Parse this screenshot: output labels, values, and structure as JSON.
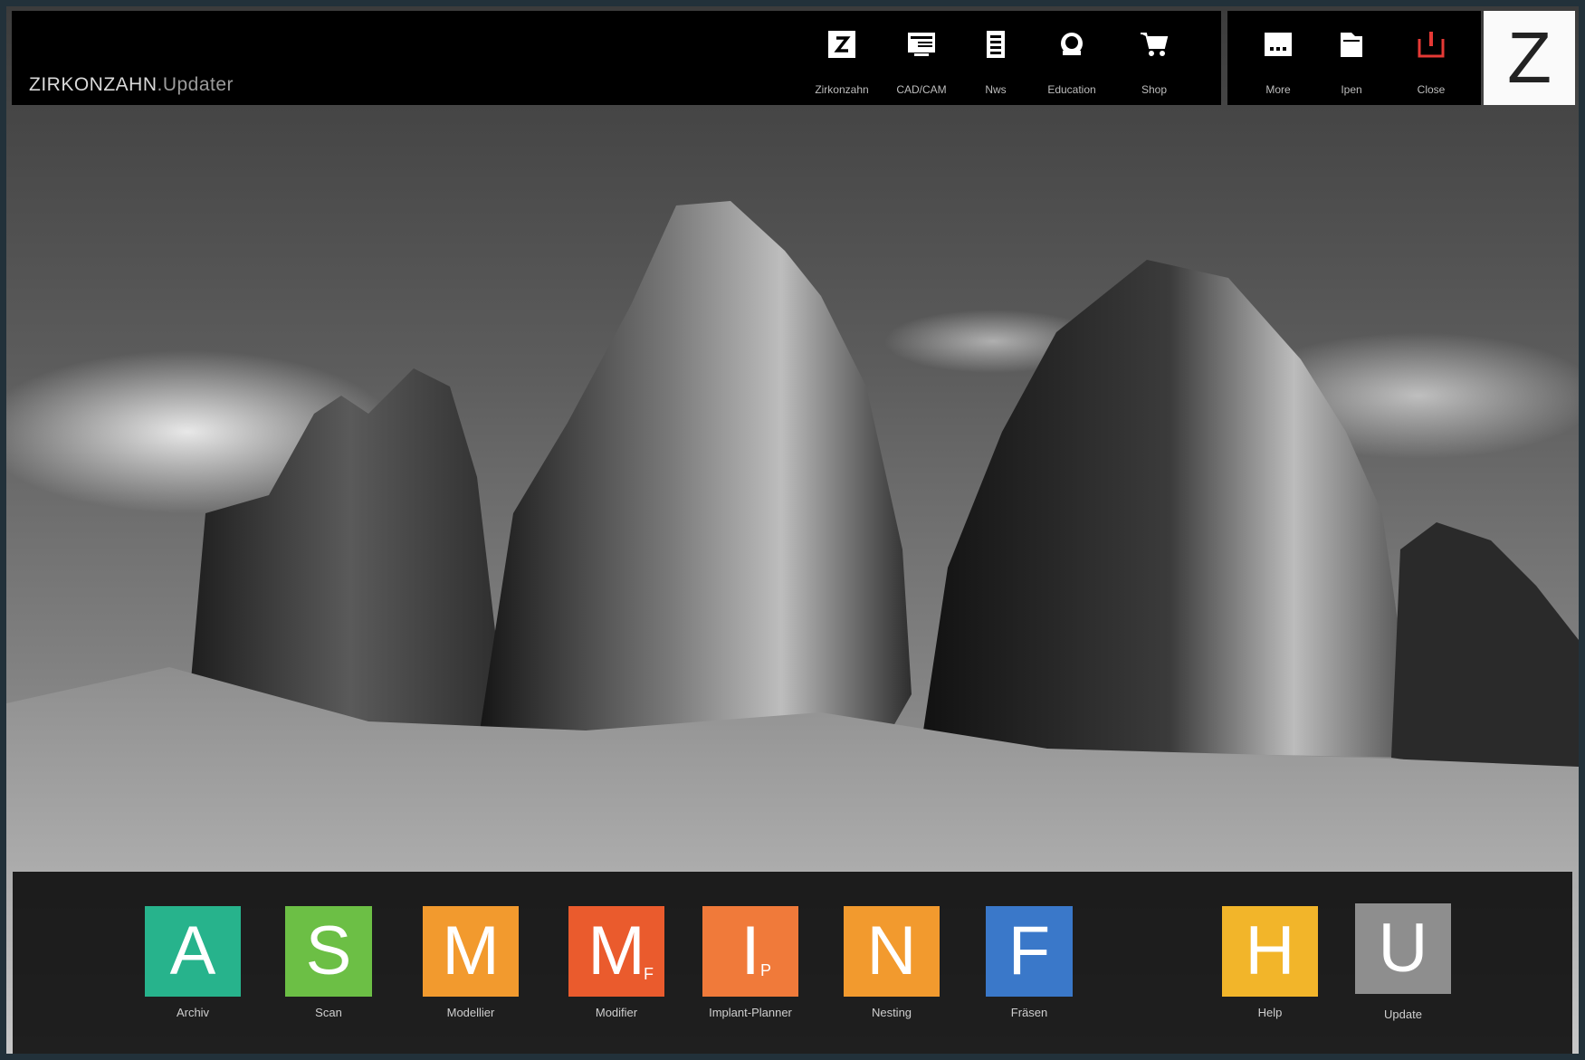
{
  "header": {
    "title_main": "ZIRKONZAHN",
    "title_sub": ".Updater",
    "nav": [
      {
        "label": "Zirkonzahn",
        "icon": "z-logo-icon"
      },
      {
        "label": "CAD/CAM",
        "icon": "monitor-icon"
      },
      {
        "label": "Nws",
        "icon": "news-icon"
      },
      {
        "label": "Education",
        "icon": "education-icon"
      },
      {
        "label": "Shop",
        "icon": "cart-icon"
      }
    ],
    "actions": [
      {
        "label": "More",
        "icon": "more-icon"
      },
      {
        "label": "Ipen",
        "icon": "folder-icon"
      },
      {
        "label": "Close",
        "icon": "power-icon",
        "color": "#e53935"
      }
    ],
    "logo_letter": "Z"
  },
  "dock": {
    "tiles": [
      {
        "letter": "A",
        "sub": "",
        "label": "Archiv",
        "color": "#27b38c"
      },
      {
        "letter": "S",
        "sub": "",
        "label": "Scan",
        "color": "#6cbf45"
      },
      {
        "letter": "M",
        "sub": "",
        "label": "Modellier",
        "color": "#f29a2e"
      },
      {
        "letter": "M",
        "sub": "F",
        "label": "Modifier",
        "color": "#ea5b2d"
      },
      {
        "letter": "I",
        "sub": "P",
        "label": "Implant-Planner",
        "color": "#f07a3a"
      },
      {
        "letter": "N",
        "sub": "",
        "label": "Nesting",
        "color": "#f29a2e"
      },
      {
        "letter": "F",
        "sub": "",
        "label": "Fräsen",
        "color": "#3a78c9"
      },
      {
        "letter": "H",
        "sub": "",
        "label": "Help",
        "color": "#f2b52a"
      },
      {
        "letter": "U",
        "sub": "",
        "label": "Update",
        "color": "#8e8e8e"
      }
    ]
  }
}
